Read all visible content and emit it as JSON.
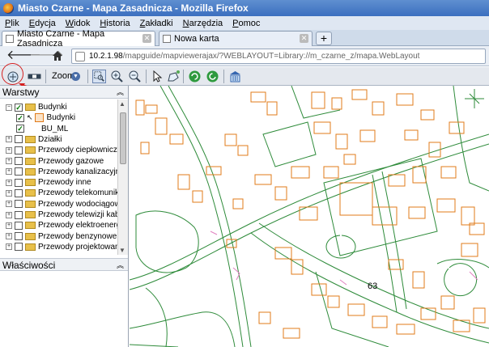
{
  "window": {
    "title": "Miasto Czarne - Mapa Zasadnicza - Mozilla Firefox"
  },
  "menu": [
    "Plik",
    "Edycja",
    "Widok",
    "Historia",
    "Zakładki",
    "Narzędzia",
    "Pomoc"
  ],
  "tabs": [
    {
      "label": "Miasto Czarne - Mapa Zasadnicza",
      "active": true
    },
    {
      "label": "Nowa karta",
      "active": false
    }
  ],
  "address": {
    "host": "10.2.1.98",
    "path": "/mapguide/mapviewerajax/?WEBLAYOUT=Library://m_czarne_z/mapa.WebLayout"
  },
  "toolbar": {
    "zoom_label": "Zoom"
  },
  "panels": {
    "layers_title": "Warstwy",
    "properties_title": "Właściwości"
  },
  "layers": [
    {
      "label": "Budynki",
      "level": 0,
      "checked": true,
      "type": "group",
      "expanded": true
    },
    {
      "label": "Budynki",
      "level": 1,
      "checked": true,
      "type": "layer"
    },
    {
      "label": "BU_ML",
      "level": 1,
      "checked": true,
      "type": "layer"
    },
    {
      "label": "Działki",
      "level": 0,
      "checked": false,
      "type": "group"
    },
    {
      "label": "Przewody ciepłownicze",
      "level": 0,
      "checked": false,
      "type": "group"
    },
    {
      "label": "Przewody gazowe",
      "level": 0,
      "checked": false,
      "type": "group"
    },
    {
      "label": "Przewody kanalizacyjne",
      "level": 0,
      "checked": false,
      "type": "group"
    },
    {
      "label": "Przewody inne",
      "level": 0,
      "checked": false,
      "type": "group"
    },
    {
      "label": "Przewody telekomunikacyjne",
      "level": 0,
      "checked": false,
      "type": "group"
    },
    {
      "label": "Przewody wodociągowe",
      "level": 0,
      "checked": false,
      "type": "group"
    },
    {
      "label": "Przewody telewizji kablowej",
      "level": 0,
      "checked": false,
      "type": "group"
    },
    {
      "label": "Przewody elektroenergetyczne",
      "level": 0,
      "checked": false,
      "type": "group"
    },
    {
      "label": "Przewody benzynowe",
      "level": 0,
      "checked": false,
      "type": "group"
    },
    {
      "label": "Przewody projektowane",
      "level": 0,
      "checked": false,
      "type": "group"
    }
  ],
  "map": {
    "parcel_label": "63",
    "building_color": "#e07b1a",
    "parcel_color": "#2e8b3a",
    "misc_color": "#e080c0"
  },
  "colors": {
    "titlebar": "#3b6fbf",
    "callout": "#d42020"
  }
}
